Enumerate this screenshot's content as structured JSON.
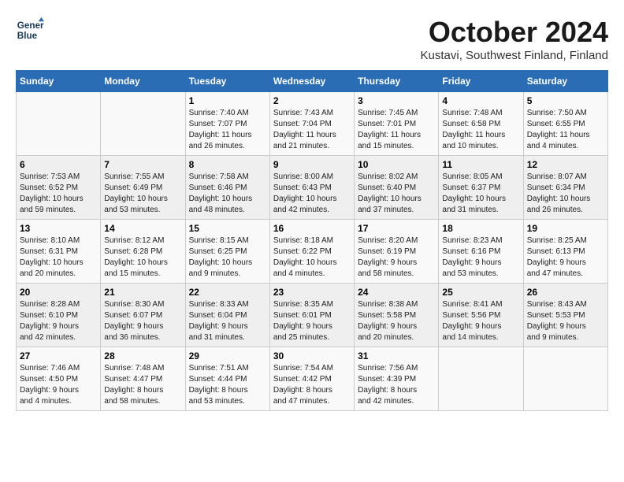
{
  "header": {
    "logo_line1": "General",
    "logo_line2": "Blue",
    "month_title": "October 2024",
    "location": "Kustavi, Southwest Finland, Finland"
  },
  "days_of_week": [
    "Sunday",
    "Monday",
    "Tuesday",
    "Wednesday",
    "Thursday",
    "Friday",
    "Saturday"
  ],
  "weeks": [
    [
      {
        "day": "",
        "info": ""
      },
      {
        "day": "",
        "info": ""
      },
      {
        "day": "1",
        "info": "Sunrise: 7:40 AM\nSunset: 7:07 PM\nDaylight: 11 hours\nand 26 minutes."
      },
      {
        "day": "2",
        "info": "Sunrise: 7:43 AM\nSunset: 7:04 PM\nDaylight: 11 hours\nand 21 minutes."
      },
      {
        "day": "3",
        "info": "Sunrise: 7:45 AM\nSunset: 7:01 PM\nDaylight: 11 hours\nand 15 minutes."
      },
      {
        "day": "4",
        "info": "Sunrise: 7:48 AM\nSunset: 6:58 PM\nDaylight: 11 hours\nand 10 minutes."
      },
      {
        "day": "5",
        "info": "Sunrise: 7:50 AM\nSunset: 6:55 PM\nDaylight: 11 hours\nand 4 minutes."
      }
    ],
    [
      {
        "day": "6",
        "info": "Sunrise: 7:53 AM\nSunset: 6:52 PM\nDaylight: 10 hours\nand 59 minutes."
      },
      {
        "day": "7",
        "info": "Sunrise: 7:55 AM\nSunset: 6:49 PM\nDaylight: 10 hours\nand 53 minutes."
      },
      {
        "day": "8",
        "info": "Sunrise: 7:58 AM\nSunset: 6:46 PM\nDaylight: 10 hours\nand 48 minutes."
      },
      {
        "day": "9",
        "info": "Sunrise: 8:00 AM\nSunset: 6:43 PM\nDaylight: 10 hours\nand 42 minutes."
      },
      {
        "day": "10",
        "info": "Sunrise: 8:02 AM\nSunset: 6:40 PM\nDaylight: 10 hours\nand 37 minutes."
      },
      {
        "day": "11",
        "info": "Sunrise: 8:05 AM\nSunset: 6:37 PM\nDaylight: 10 hours\nand 31 minutes."
      },
      {
        "day": "12",
        "info": "Sunrise: 8:07 AM\nSunset: 6:34 PM\nDaylight: 10 hours\nand 26 minutes."
      }
    ],
    [
      {
        "day": "13",
        "info": "Sunrise: 8:10 AM\nSunset: 6:31 PM\nDaylight: 10 hours\nand 20 minutes."
      },
      {
        "day": "14",
        "info": "Sunrise: 8:12 AM\nSunset: 6:28 PM\nDaylight: 10 hours\nand 15 minutes."
      },
      {
        "day": "15",
        "info": "Sunrise: 8:15 AM\nSunset: 6:25 PM\nDaylight: 10 hours\nand 9 minutes."
      },
      {
        "day": "16",
        "info": "Sunrise: 8:18 AM\nSunset: 6:22 PM\nDaylight: 10 hours\nand 4 minutes."
      },
      {
        "day": "17",
        "info": "Sunrise: 8:20 AM\nSunset: 6:19 PM\nDaylight: 9 hours\nand 58 minutes."
      },
      {
        "day": "18",
        "info": "Sunrise: 8:23 AM\nSunset: 6:16 PM\nDaylight: 9 hours\nand 53 minutes."
      },
      {
        "day": "19",
        "info": "Sunrise: 8:25 AM\nSunset: 6:13 PM\nDaylight: 9 hours\nand 47 minutes."
      }
    ],
    [
      {
        "day": "20",
        "info": "Sunrise: 8:28 AM\nSunset: 6:10 PM\nDaylight: 9 hours\nand 42 minutes."
      },
      {
        "day": "21",
        "info": "Sunrise: 8:30 AM\nSunset: 6:07 PM\nDaylight: 9 hours\nand 36 minutes."
      },
      {
        "day": "22",
        "info": "Sunrise: 8:33 AM\nSunset: 6:04 PM\nDaylight: 9 hours\nand 31 minutes."
      },
      {
        "day": "23",
        "info": "Sunrise: 8:35 AM\nSunset: 6:01 PM\nDaylight: 9 hours\nand 25 minutes."
      },
      {
        "day": "24",
        "info": "Sunrise: 8:38 AM\nSunset: 5:58 PM\nDaylight: 9 hours\nand 20 minutes."
      },
      {
        "day": "25",
        "info": "Sunrise: 8:41 AM\nSunset: 5:56 PM\nDaylight: 9 hours\nand 14 minutes."
      },
      {
        "day": "26",
        "info": "Sunrise: 8:43 AM\nSunset: 5:53 PM\nDaylight: 9 hours\nand 9 minutes."
      }
    ],
    [
      {
        "day": "27",
        "info": "Sunrise: 7:46 AM\nSunset: 4:50 PM\nDaylight: 9 hours\nand 4 minutes."
      },
      {
        "day": "28",
        "info": "Sunrise: 7:48 AM\nSunset: 4:47 PM\nDaylight: 8 hours\nand 58 minutes."
      },
      {
        "day": "29",
        "info": "Sunrise: 7:51 AM\nSunset: 4:44 PM\nDaylight: 8 hours\nand 53 minutes."
      },
      {
        "day": "30",
        "info": "Sunrise: 7:54 AM\nSunset: 4:42 PM\nDaylight: 8 hours\nand 47 minutes."
      },
      {
        "day": "31",
        "info": "Sunrise: 7:56 AM\nSunset: 4:39 PM\nDaylight: 8 hours\nand 42 minutes."
      },
      {
        "day": "",
        "info": ""
      },
      {
        "day": "",
        "info": ""
      }
    ]
  ]
}
